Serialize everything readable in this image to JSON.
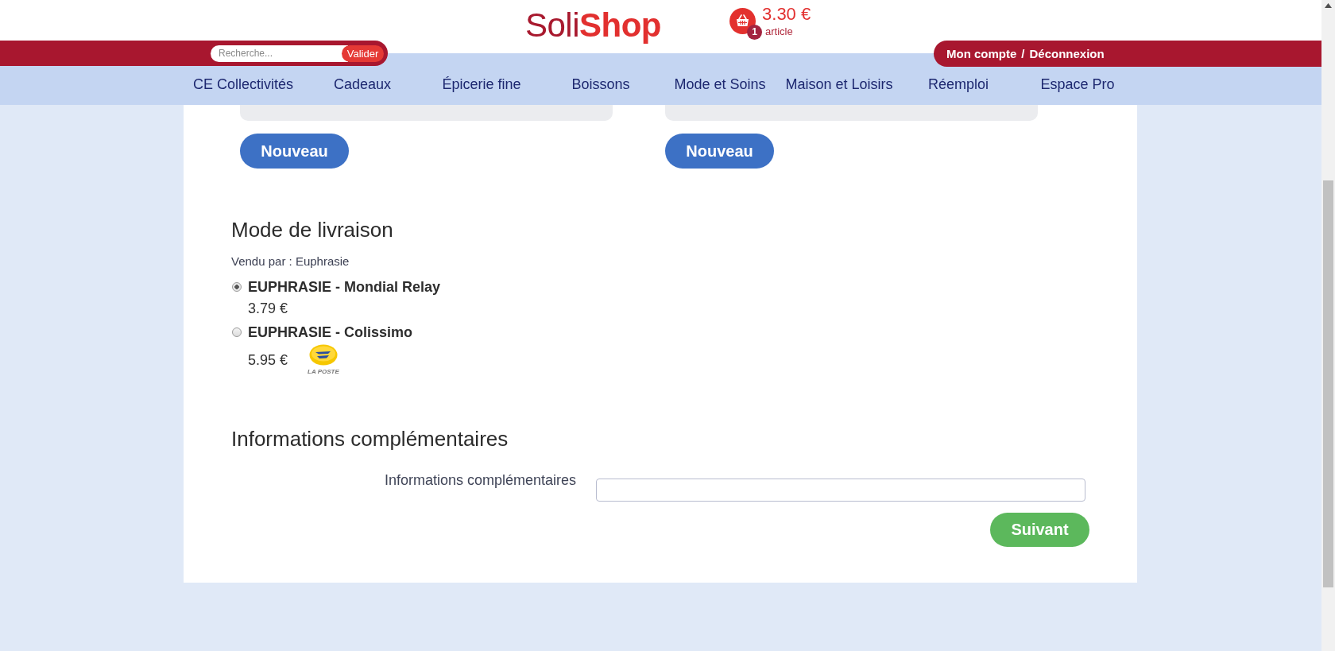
{
  "header": {
    "logo": {
      "parts": [
        "Soli",
        "Shop"
      ]
    },
    "cart": {
      "total": "3.30 €",
      "count": "1",
      "count_label": "article"
    }
  },
  "search": {
    "placeholder": "Recherche...",
    "button": "Valider"
  },
  "account": {
    "links": [
      "Mon compte",
      "Déconnexion"
    ],
    "separator": "/"
  },
  "nav": {
    "items": [
      {
        "label": "CE Collectivités"
      },
      {
        "label": "Cadeaux"
      },
      {
        "label": "Épicerie fine"
      },
      {
        "label": "Boissons"
      },
      {
        "label": "Mode et Soins"
      },
      {
        "label": "Maison et Loisirs"
      },
      {
        "label": "Réemploi"
      },
      {
        "label": "Espace Pro"
      }
    ]
  },
  "address_columns": [
    {
      "button": "Nouveau"
    },
    {
      "button": "Nouveau"
    }
  ],
  "delivery": {
    "title": "Mode de livraison",
    "seller": "Vendu par : Euphrasie",
    "options": [
      {
        "label": "EUPHRASIE - Mondial Relay",
        "price": "3.79 €",
        "selected": true
      },
      {
        "label": "EUPHRASIE - Colissimo",
        "price": "5.95 €",
        "selected": false,
        "logo": {
          "caption": "LA POSTE"
        }
      }
    ]
  },
  "extra_info": {
    "title": "Informations complémentaires",
    "field_label": "Informations complémentaires",
    "submit": "Suivant"
  }
}
